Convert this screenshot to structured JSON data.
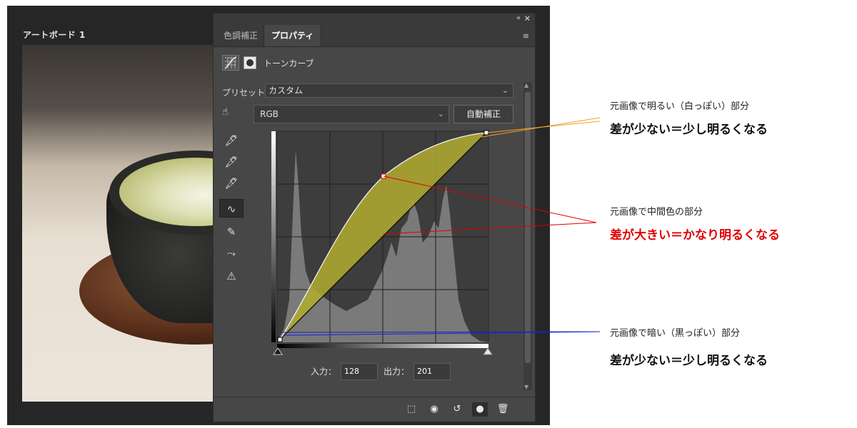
{
  "artboard": {
    "label": "アートボード 1"
  },
  "panel": {
    "tabs": [
      {
        "label": "色調補正"
      },
      {
        "label": "プロパティ"
      }
    ],
    "adjustment_title": "トーンカーブ",
    "preset_label": "プリセット：",
    "preset_value": "カスタム",
    "channel_value": "RGB",
    "auto_button": "自動補正",
    "input_label": "入力：",
    "input_value": "128",
    "output_label": "出力：",
    "output_value": "201"
  },
  "annotations": [
    {
      "small": "元画像で明るい（白っぽい）部分",
      "big": "差が少ない＝少し明るくなる",
      "color": "#111111"
    },
    {
      "small": "元画像で中間色の部分",
      "big": "差が大きい＝かなり明るくなる",
      "color": "#e00000"
    },
    {
      "small": "元画像で暗い（黒っぽい）部分",
      "big": "差が少ない＝少し明るくなる",
      "color": "#111111"
    }
  ],
  "curve": {
    "control_points": [
      [
        0,
        0
      ],
      [
        128,
        201
      ],
      [
        255,
        255
      ]
    ],
    "fill_color": "#b3ad2f",
    "leader_colors": {
      "highlight": "#f0a030",
      "midtone": "#e00000",
      "shadow": "#1a22c8"
    }
  },
  "icons": {
    "panel_collapse": "«",
    "panel_close": "×",
    "panel_menu": "≡",
    "target_adjust": "☝",
    "footer": [
      "clip-to-layer-icon",
      "view-previous-icon",
      "reset-icon",
      "visibility-icon",
      "trash-icon"
    ]
  }
}
